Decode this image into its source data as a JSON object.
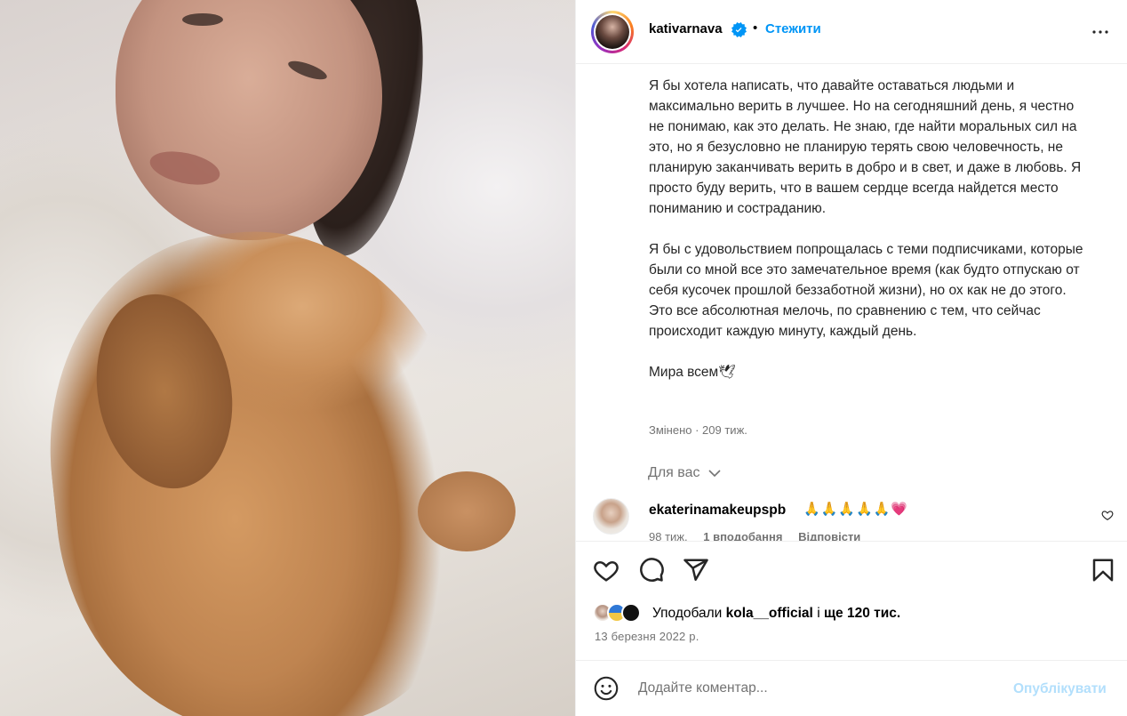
{
  "post": {
    "image_alt": "",
    "author": {
      "username": "kativarnava",
      "verified": true,
      "separator": "•",
      "follow_label": "Стежити"
    },
    "caption": [
      "Я бы хотела написать, что давайте оставаться людьми и максимально верить в лучшее. Но на сегодняшний день, я честно не понимаю, как это делать. Не знаю, где найти моральных сил на это, но я безусловно не планирую терять свою человечность, не планирую заканчивать верить в добро и в свет, и даже в любовь. Я просто буду верить, что в вашем сердце всегда найдется место пониманию и состраданию.",
      "Я бы с удовольствием попрощалась с теми подписчиками, которые были со мной все это замечательное время (как будто отпускаю от себя кусочек прошлой беззаботной жизни), но ох как не до этого. Это все абсолютная мелочь, по сравнению с тем, что сейчас происходит каждую минуту, каждый день.",
      "Мира всем🕊"
    ],
    "edited_meta": "Змінено · 209 тиж.",
    "for_you_label": "Для вас",
    "comments": [
      {
        "username": "ekaterinamakeupspb",
        "text": "🙏🙏🙏🙏🙏💗",
        "age": "98 тиж.",
        "likes": "1 вподобання",
        "reply_label": "Відповісти"
      }
    ],
    "liked_by": {
      "prefix": "Уподобали",
      "user": "kola__official",
      "middle": "і",
      "rest": "ще 120 тис."
    },
    "date": "13 березня 2022 р.",
    "add_comment": {
      "placeholder": "Додайте коментар...",
      "publish_label": "Опублікувати"
    }
  },
  "icons": {
    "more": "more-options-icon",
    "like": "heart-icon",
    "comment": "comment-icon",
    "share": "share-icon",
    "save": "bookmark-icon",
    "emoji": "emoji-icon",
    "verified": "verified-badge-icon"
  },
  "colors": {
    "accent": "#0095f6",
    "publish_disabled": "#b2dffc",
    "secondary_text": "#737373",
    "divider": "#efefef"
  }
}
